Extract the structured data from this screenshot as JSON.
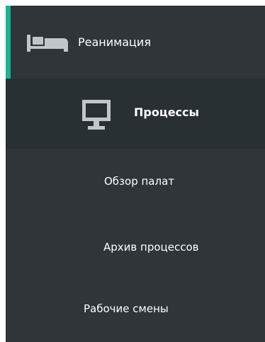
{
  "colors": {
    "panel_bg": "#2f3539",
    "submenu_bg": "#293034",
    "accent": "#1bb394",
    "text": "#ffffff",
    "icon": "#c3c6c8"
  },
  "menu": {
    "top": {
      "label": "Реанимация",
      "icon": "bed-icon"
    },
    "submenu": {
      "label": "Процессы",
      "icon": "monitor-icon"
    },
    "items": [
      {
        "label": "Обзор палат"
      },
      {
        "label": "Архив процессов"
      },
      {
        "label": "Рабочие смены"
      }
    ]
  }
}
